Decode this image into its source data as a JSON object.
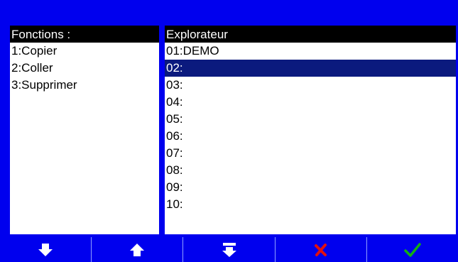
{
  "functions": {
    "header": "Fonctions :",
    "items": [
      "1:Copier",
      "2:Coller",
      "3:Supprimer"
    ]
  },
  "explorer": {
    "header": "Explorateur",
    "selected_index": 1,
    "items": [
      "01:DEMO",
      "02:",
      "03:",
      "04:",
      "05:",
      "06:",
      "07:",
      "08:",
      "09:",
      "10:"
    ]
  },
  "toolbar": {
    "buttons": [
      {
        "icon": "arrow-down-icon"
      },
      {
        "icon": "arrow-up-icon"
      },
      {
        "icon": "double-arrow-down-icon"
      },
      {
        "icon": "cancel-x-icon"
      },
      {
        "icon": "confirm-check-icon"
      }
    ]
  },
  "colors": {
    "background": "#0000ee",
    "selection": "#0b1a7e",
    "cancel": "#e01010",
    "confirm": "#12b012"
  }
}
